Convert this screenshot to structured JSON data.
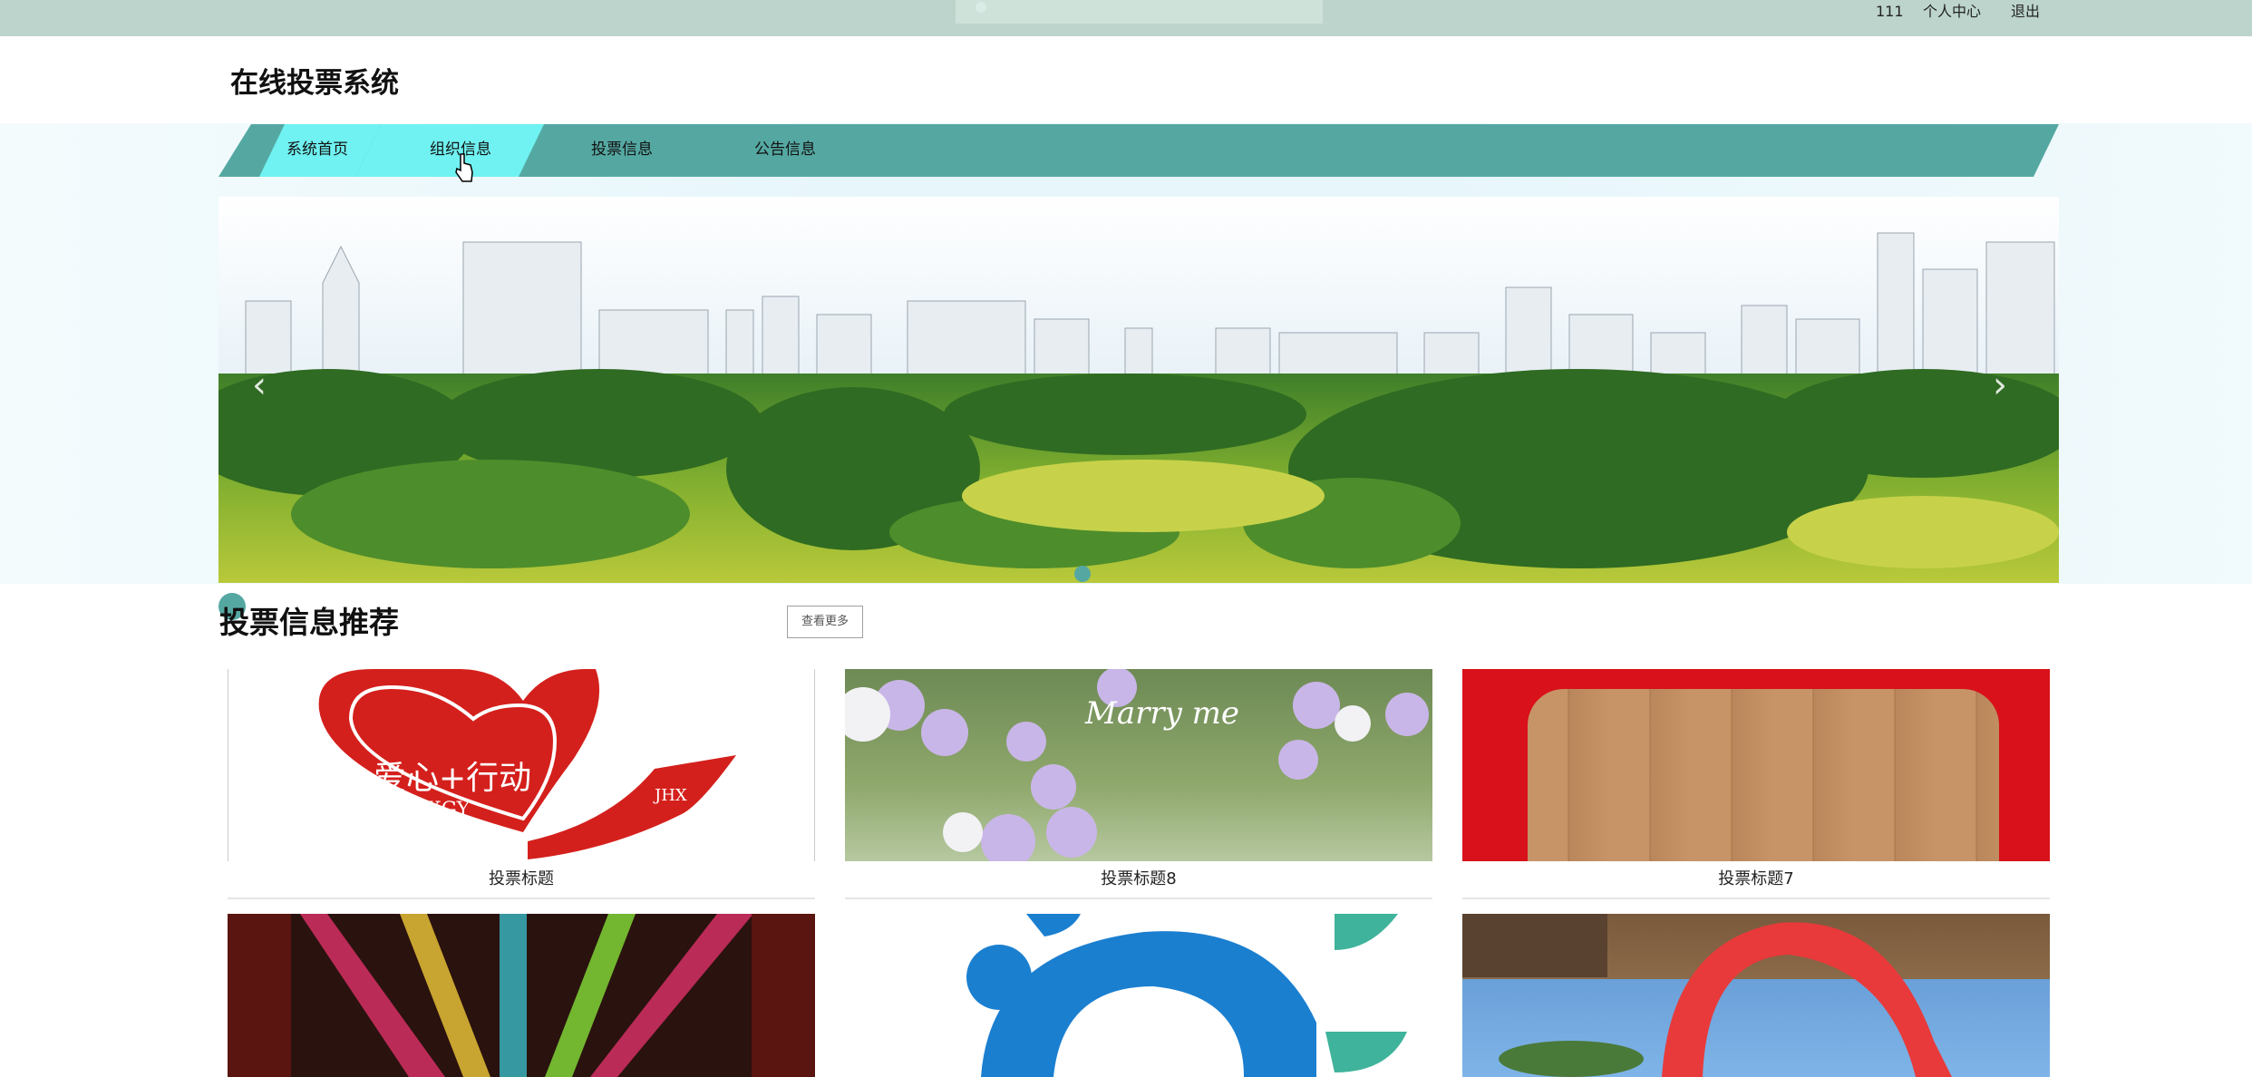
{
  "topbar": {
    "username": "111",
    "profile_label": "个人中心",
    "logout_label": "退出"
  },
  "header": {
    "title": "在线投票系统"
  },
  "nav": {
    "items": [
      {
        "label": "系统首页"
      },
      {
        "label": "组织信息"
      },
      {
        "label": "投票信息"
      },
      {
        "label": "公告信息"
      }
    ]
  },
  "banner": {
    "prev_label": "‹",
    "next_label": "›"
  },
  "section": {
    "title": "投票信息推荐",
    "more_label": "查看更多",
    "cards": [
      {
        "caption": "投票标题",
        "image_text": "爱心+行动",
        "image_subtext": "JXGY",
        "image_mark": "JHX"
      },
      {
        "caption": "投票标题8",
        "image_text": "Marry me"
      },
      {
        "caption": "投票标题7"
      },
      {
        "caption": ""
      },
      {
        "caption": ""
      },
      {
        "caption": ""
      }
    ]
  },
  "colors": {
    "topbar": "#bcd4cc",
    "nav": "#55a8a2",
    "nav_active": "#6ff2f1",
    "accent_red": "#d4201c"
  }
}
